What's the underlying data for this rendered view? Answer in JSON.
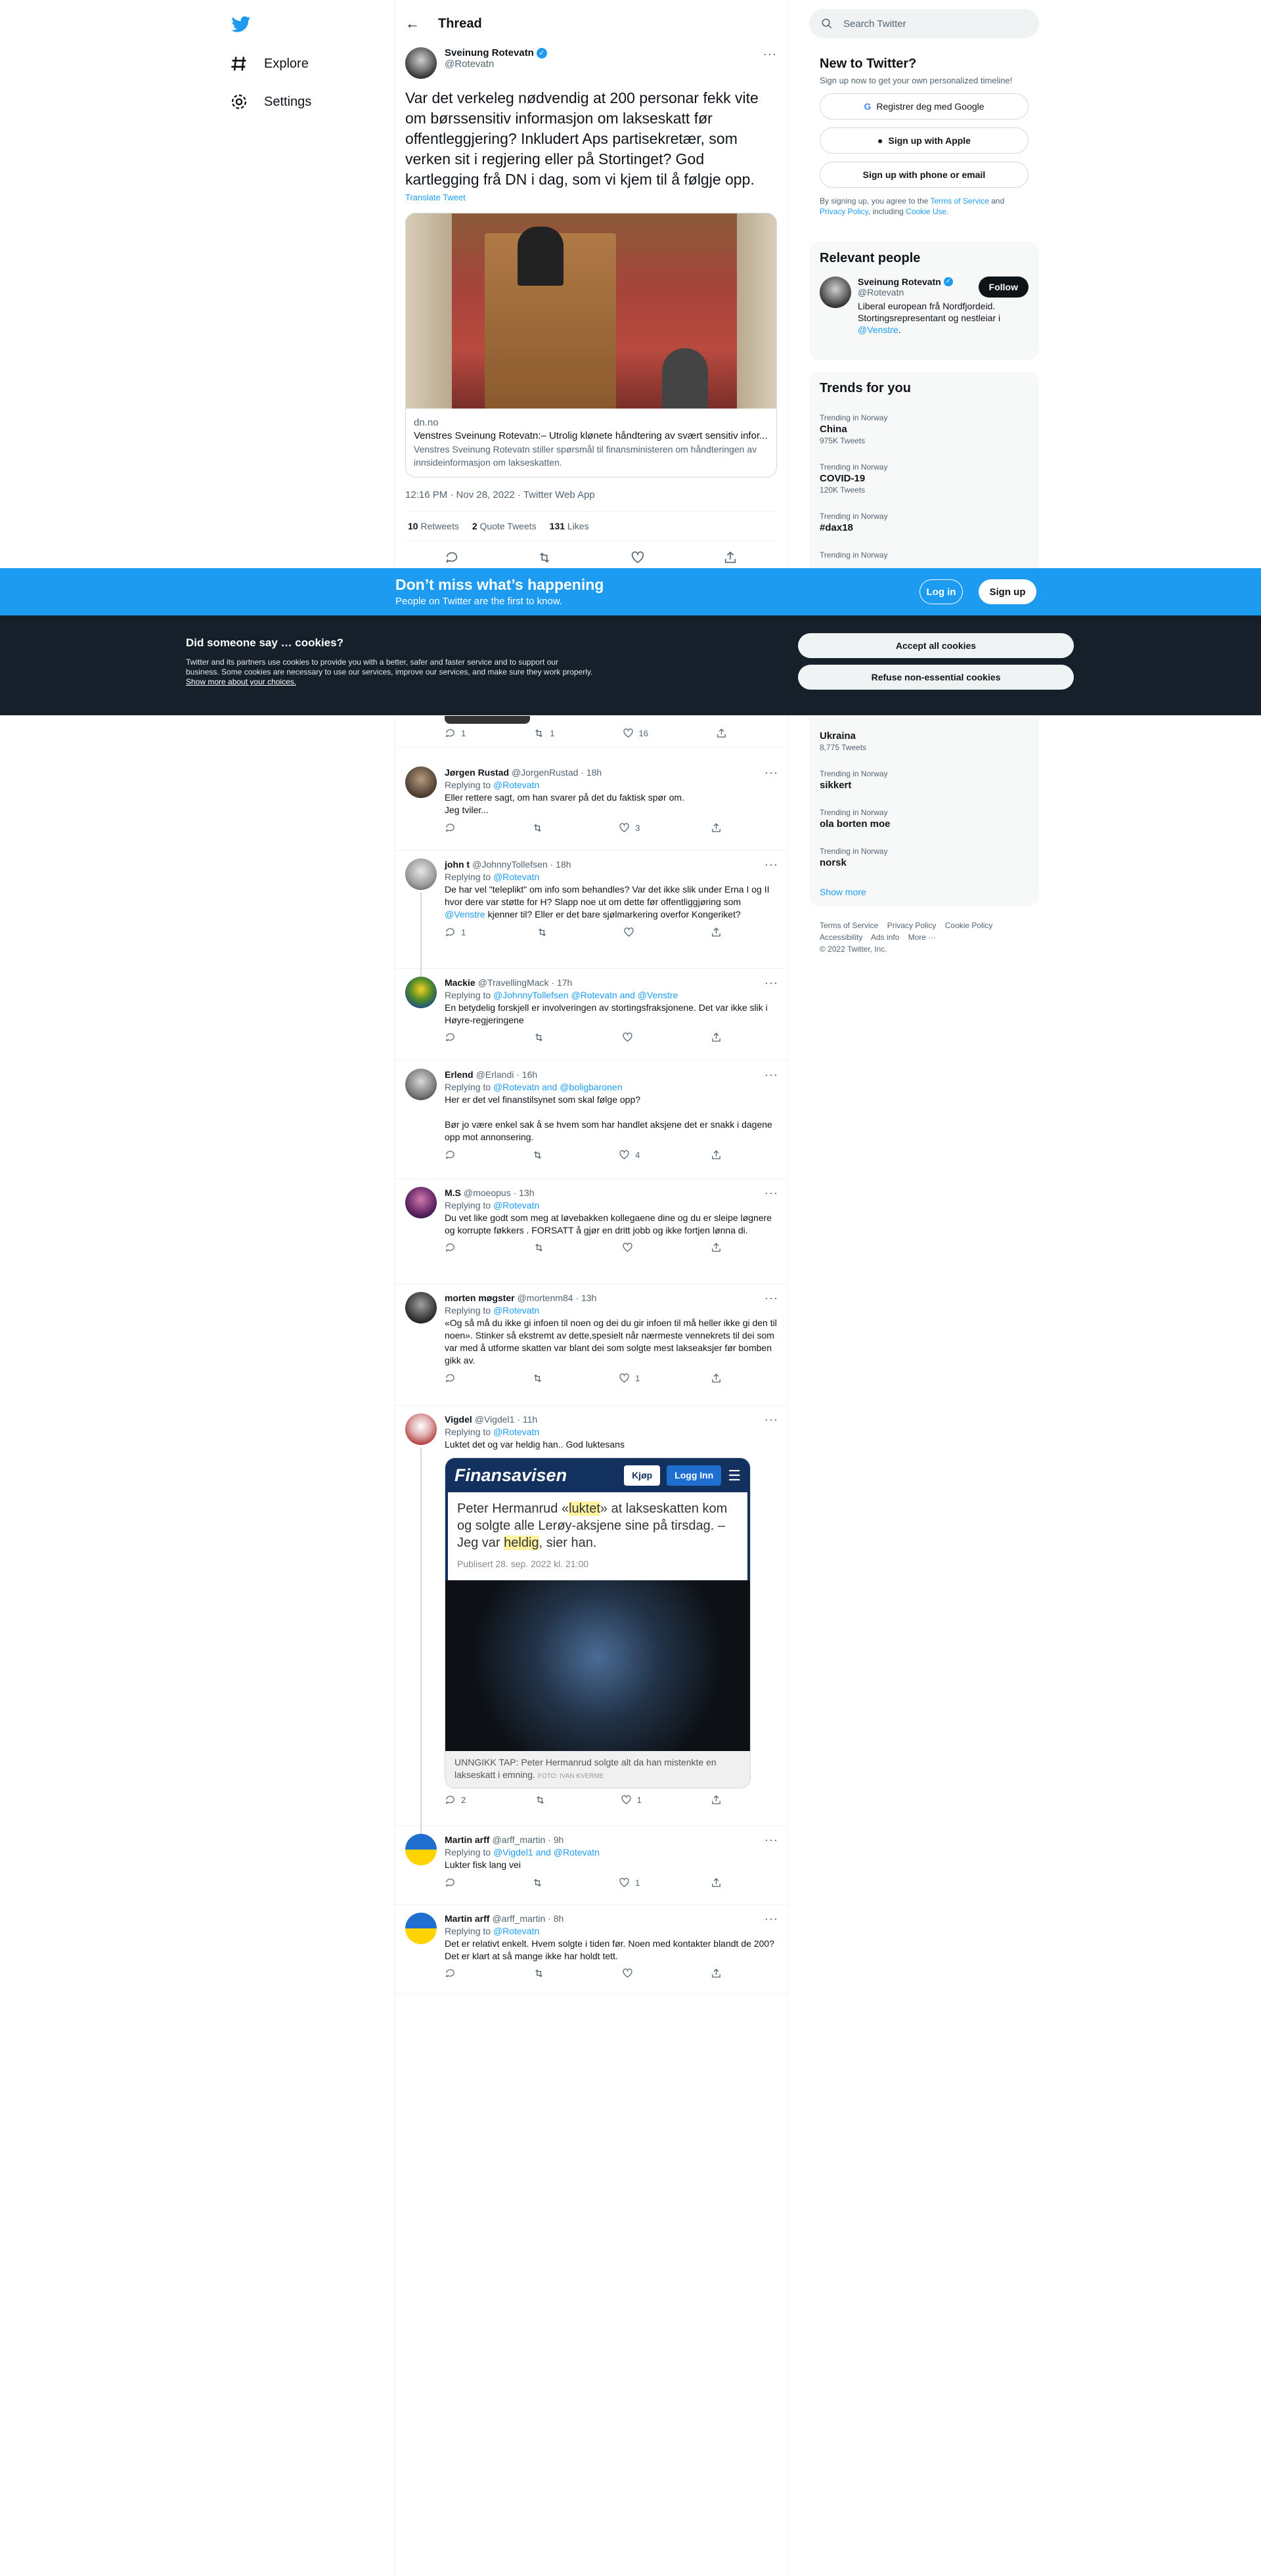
{
  "nav": {
    "explore": "Explore",
    "settings": "Settings"
  },
  "header": {
    "title": "Thread"
  },
  "tweet": {
    "name": "Sveinung Rotevatn",
    "handle": "@Rotevatn",
    "text": "Var det verkeleg nødvendig at 200 personar fekk vite om børssensitiv informasjon om lakseskatt før offentleggjering? Inkludert Aps partisekretær, som verken sit i regjering eller på Stortinget? God kartlegging frå DN i dag, som vi kjem til å følgje opp.",
    "translate": "Translate Tweet",
    "card": {
      "domain": "dn.no",
      "title": "Venstres Sveinung Rotevatn:– Utrolig klønete håndtering av svært sensitiv infor...",
      "desc": "Venstres Sveinung Rotevatn stiller spørsmål til finansministeren om håndteringen av innsideinformasjon om lakseskatten."
    },
    "meta": "12:16 PM · Nov 28, 2022 · Twitter Web App",
    "stats": {
      "retweets": "10",
      "retweets_label": "Retweets",
      "quotes": "2",
      "quotes_label": "Quote Tweets",
      "likes": "131",
      "likes_label": "Likes"
    }
  },
  "replies": [
    {
      "name": "Jørgen Rustad",
      "handle": "@JorgenRustad · 18h",
      "replying": "Replying to",
      "to": "@Rotevatn",
      "text": "Eller rettere sagt, om han svarer på det du faktisk spør om.\nJeg tviler...",
      "replies": "",
      "retweets": "",
      "likes": "3"
    },
    {
      "name": "john t",
      "handle": "@JohnnyTollefsen · 18h",
      "replying": "Replying to",
      "to": "@Rotevatn",
      "text": "De har vel \"teleplikt\" om info som behandles? Var det ikke slik under Erna I og II hvor dere var støtte for H? Slapp noe ut om dette før offentliggjøring som",
      "mention": "@Venstre",
      "text2": " kjenner til? Eller er det bare sjølmarkering overfor Kongeriket?",
      "replies": "1",
      "retweets": "",
      "likes": ""
    },
    {
      "name": "Mackie",
      "handle": "@TravellingMack · 17h",
      "replying": "Replying to",
      "to": "@JohnnyTollefsen @Rotevatn and @Venstre",
      "text": "En betydelig forskjell er involveringen av stortingsfraksjonene. Det var ikke slik i Høyre-regjeringene",
      "replies": "",
      "retweets": "",
      "likes": ""
    },
    {
      "name": "Erlend",
      "handle": "@Erlandi · 16h",
      "replying": "Replying to",
      "to": "@Rotevatn and @boligbaronen",
      "text": "Her er det vel finanstilsynet som skal følge opp?\n\nBør jo være enkel sak å se hvem som har handlet aksjene det er snakk i dagene opp mot annonsering.",
      "replies": "",
      "retweets": "",
      "likes": "4"
    },
    {
      "name": "M.S",
      "handle": "@moeopus · 13h",
      "replying": "Replying to",
      "to": "@Rotevatn",
      "text": "Du vet like godt som meg at løvebakken kollegaene dine og du er sleipe løgnere og korrupte føkkers . FORSATT å gjør en dritt jobb og ikke fortjen lønna di.",
      "replies": "",
      "retweets": "",
      "likes": ""
    },
    {
      "name": "morten møgster",
      "handle": "@mortenm84 · 13h",
      "replying": "Replying to",
      "to": "@Rotevatn",
      "text": "«Og så må du ikke gi infoen til noen og dei du gir infoen til må heller ikke gi den til noen». Stinker så ekstremt av dette,spesielt når nærmeste vennekrets til dei som var med å utforme skatten var blant dei som solgte mest lakseaksjer før bomben gikk av.",
      "replies": "",
      "retweets": "",
      "likes": "1"
    },
    {
      "name": "Vigdel",
      "handle": "@Vigdel1 · 11h",
      "replying": "Replying to",
      "to": "@Rotevatn",
      "text": "Luktet det og var heldig han.. God luktesans",
      "replies": "2",
      "retweets": "",
      "likes": "1"
    },
    {
      "name": "Martin arff",
      "handle": "@arff_martin · 9h",
      "replying": "Replying to",
      "to": "@Vigdel1 and @Rotevatn",
      "text": "Lukter fisk lang vei",
      "replies": "",
      "retweets": "",
      "likes": "1"
    },
    {
      "name": "Martin arff",
      "handle": "@arff_martin · 8h",
      "replying": "Replying to",
      "to": "@Rotevatn",
      "text": "Det er relativt enkelt. Hvem solgte i tiden før. Noen med kontakter blandt de 200? Det er klart at så mange ikke har holdt tett.",
      "replies": "",
      "retweets": "",
      "likes": ""
    }
  ],
  "hidden_reply": {
    "replies": "1",
    "retweets": "1",
    "likes": "16"
  },
  "fin": {
    "brand": "Finansavisen",
    "buy": "Kjøp",
    "login": "Logg Inn",
    "h1": "Peter Hermanrud «",
    "hl1": "luktet",
    "h2": "» at lakseskatten kom og solgte alle Lerøy-aksjene sine på tirsdag. – Jeg var ",
    "hl2": "heldig",
    "h3": ", sier han.",
    "pub": "Publisert 28. sep. 2022 kl. 21:00",
    "cap": "UNNGIKK TAP: Peter Hermanrud solgte alt da han mistenkte en lakseskatt i emning.",
    "credit": "FOTO: IVAN KVERME"
  },
  "right": {
    "search": "Search Twitter",
    "new": {
      "title": "New to Twitter?",
      "sub": "Sign up now to get your own personalized timeline!",
      "google": "Registrer deg med Google",
      "apple": "Sign up with Apple",
      "phone": "Sign up with phone or email",
      "terms1": "By signing up, you agree to the ",
      "tos": "Terms of Service",
      "and": " and ",
      "pp": "Privacy Policy",
      "incl": ", including ",
      "cu": "Cookie Use",
      "dot": "."
    },
    "people": {
      "title": "Relevant people",
      "name": "Sveinung Rotevatn",
      "handle": "@Rotevatn",
      "follow": "Follow",
      "bio": "Liberal european frå Nordfjordeid. Stortingsrepresentant og nestleiar i ",
      "bio_link": "@Venstre",
      "bio_end": "."
    },
    "trends": {
      "title": "Trends for you",
      "items": [
        {
          "k": "Trending in Norway",
          "t": "China",
          "c": "975K Tweets"
        },
        {
          "k": "Trending in Norway",
          "t": "COVID-19",
          "c": "120K Tweets"
        },
        {
          "k": "Trending in Norway",
          "t": "#dax18",
          "c": ""
        },
        {
          "k": "Trending in Norway",
          "t": "",
          "c": ""
        }
      ],
      "items2": [
        {
          "k": "",
          "t": "Ukraina",
          "c": "8,775 Tweets"
        },
        {
          "k": "Trending in Norway",
          "t": "sikkert",
          "c": ""
        },
        {
          "k": "Trending in Norway",
          "t": "ola borten moe",
          "c": ""
        },
        {
          "k": "Trending in Norway",
          "t": "norsk",
          "c": ""
        }
      ],
      "more": "Show more"
    },
    "footer": {
      "tos": "Terms of Service",
      "pp": "Privacy Policy",
      "cp": "Cookie Policy",
      "acc": "Accessibility",
      "ads": "Ads info",
      "more": "More ···",
      "copy": "© 2022 Twitter, Inc."
    }
  },
  "banner": {
    "title": "Don’t miss what’s happening",
    "sub": "People on Twitter are the first to know.",
    "login": "Log in",
    "signup": "Sign up"
  },
  "cookie": {
    "title": "Did someone say … cookies?",
    "text": "Twitter and its partners use cookies to provide you with a better, safer and faster service and to support our business. Some cookies are necessary to use our services, improve our services, and make sure they work properly.",
    "link": "Show more about your choices.",
    "accept": "Accept all cookies",
    "refuse": "Refuse non-essential cookies"
  },
  "colors": {
    "accent": "#1d9bf0",
    "dark": "#15202b"
  }
}
